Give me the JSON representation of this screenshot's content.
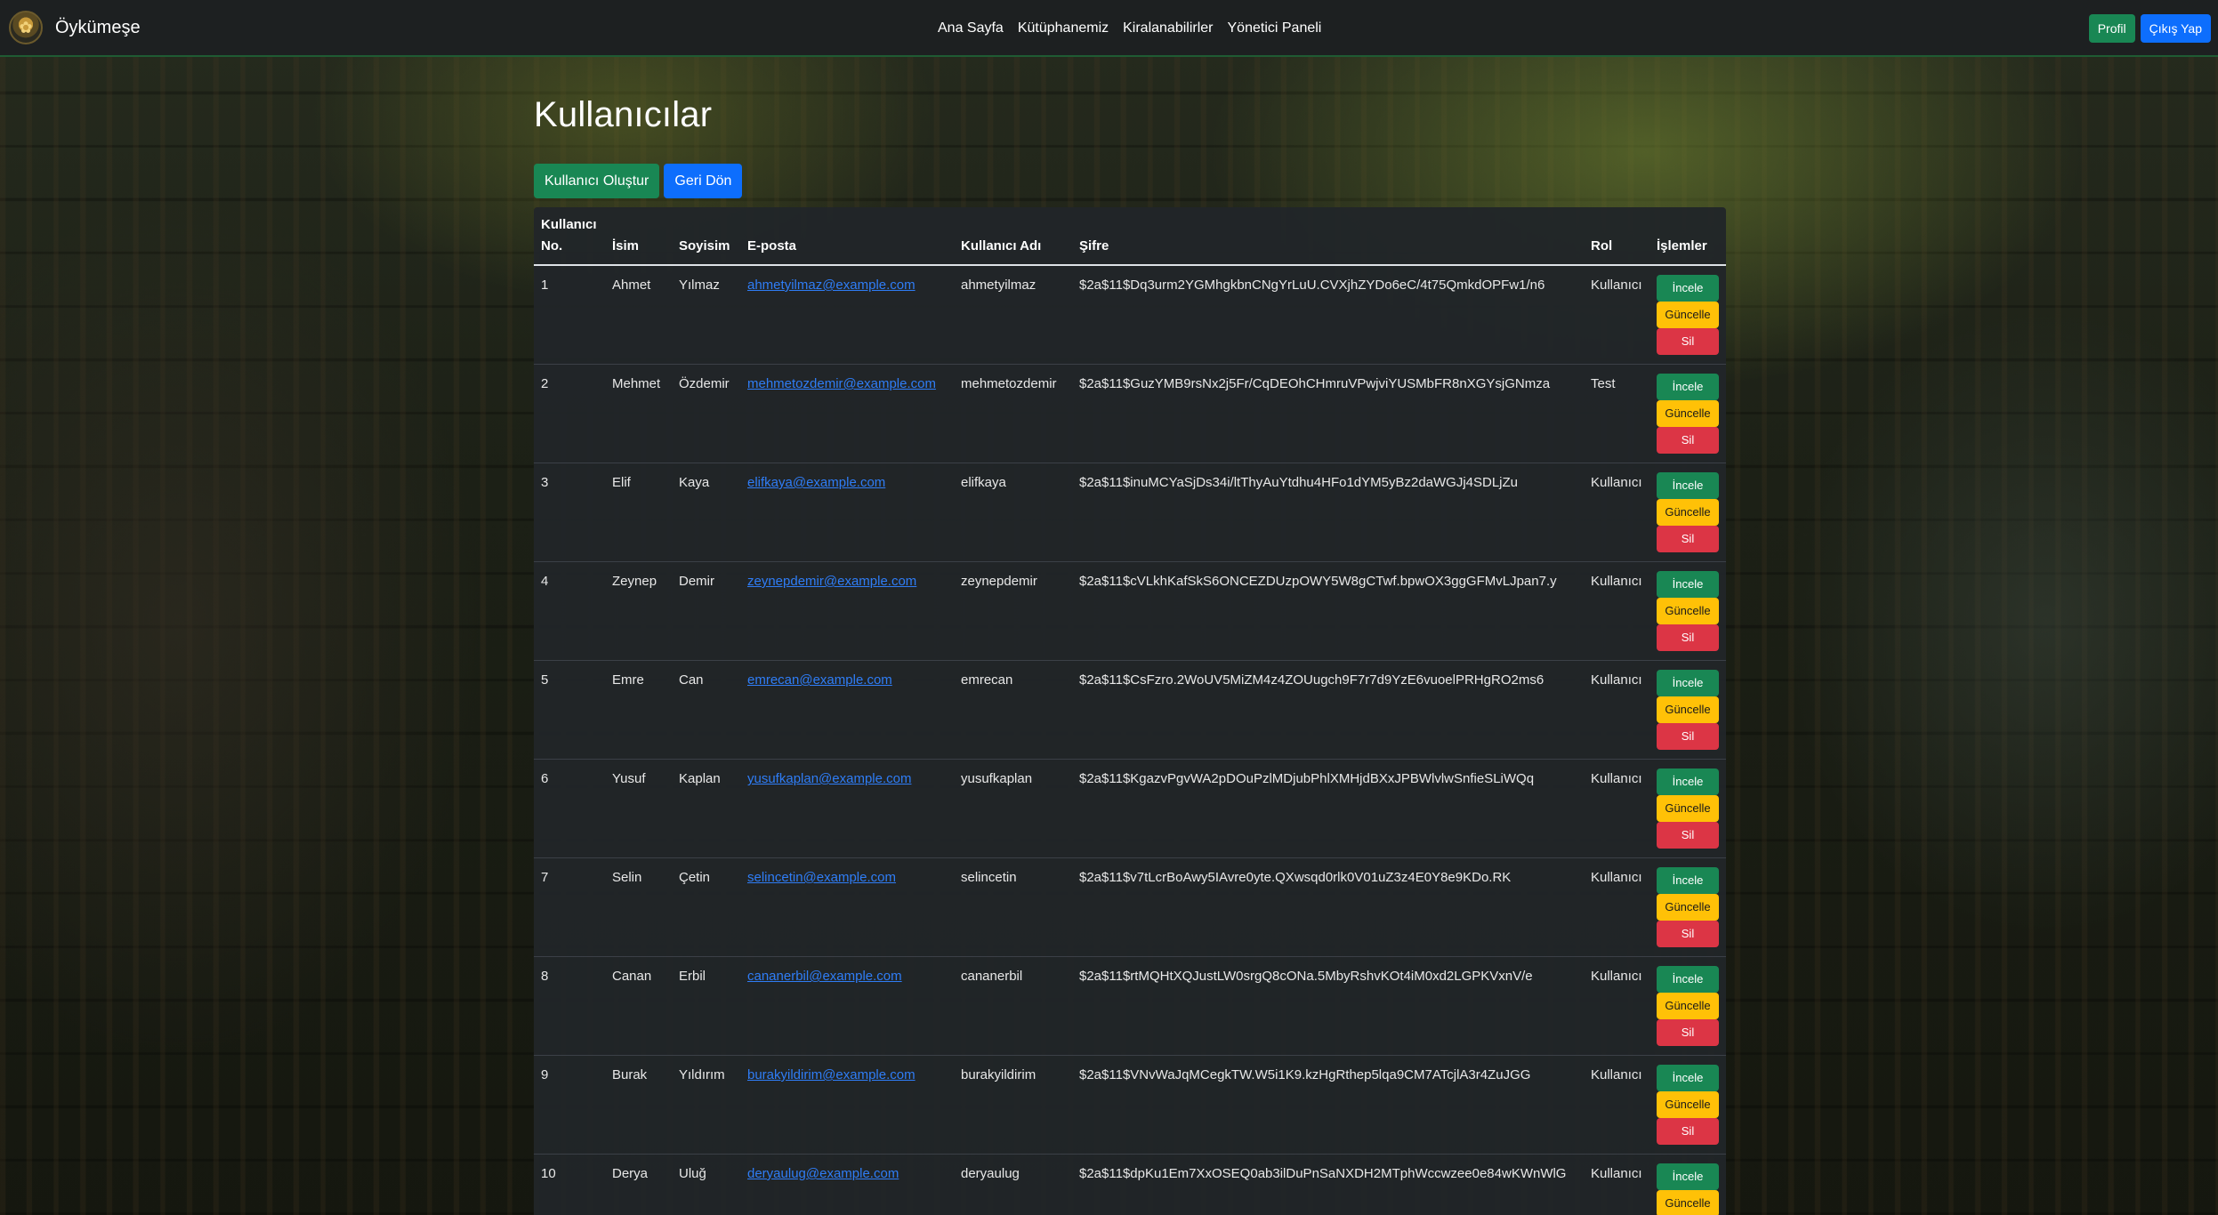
{
  "nav": {
    "brand": "Öykümeşe",
    "links": [
      "Ana Sayfa",
      "Kütüphanemiz",
      "Kiralanabilirler",
      "Yönetici Paneli"
    ],
    "profile": "Profil",
    "logout": "Çıkış Yap"
  },
  "page": {
    "title": "Kullanıcılar",
    "create_button": "Kullanıcı Oluştur",
    "back_button": "Geri Dön"
  },
  "table": {
    "headers": [
      "Kullanıcı No.",
      "İsim",
      "Soyisim",
      "E-posta",
      "Kullanıcı Adı",
      "Şifre",
      "Rol",
      "İşlemler"
    ],
    "op_labels": {
      "view": "İncele",
      "update": "Güncelle",
      "delete": "Sil"
    },
    "rows": [
      {
        "no": "1",
        "name": "Ahmet",
        "surname": "Yılmaz",
        "email": "ahmetyilmaz@example.com",
        "username": "ahmetyilmaz",
        "password": "$2a$11$Dq3urm2YGMhgkbnCNgYrLuU.CVXjhZYDo6eC/4t75QmkdOPFw1/n6",
        "role": "Kullanıcı"
      },
      {
        "no": "2",
        "name": "Mehmet",
        "surname": "Özdemir",
        "email": "mehmetozdemir@example.com",
        "username": "mehmetozdemir",
        "password": "$2a$11$GuzYMB9rsNx2j5Fr/CqDEOhCHmruVPwjviYUSMbFR8nXGYsjGNmza",
        "role": "Test"
      },
      {
        "no": "3",
        "name": "Elif",
        "surname": "Kaya",
        "email": "elifkaya@example.com",
        "username": "elifkaya",
        "password": "$2a$11$inuMCYaSjDs34i/ltThyAuYtdhu4HFo1dYM5yBz2daWGJj4SDLjZu",
        "role": "Kullanıcı"
      },
      {
        "no": "4",
        "name": "Zeynep",
        "surname": "Demir",
        "email": "zeynepdemir@example.com",
        "username": "zeynepdemir",
        "password": "$2a$11$cVLkhKafSkS6ONCEZDUzpOWY5W8gCTwf.bpwOX3ggGFMvLJpan7.y",
        "role": "Kullanıcı"
      },
      {
        "no": "5",
        "name": "Emre",
        "surname": "Can",
        "email": "emrecan@example.com",
        "username": "emrecan",
        "password": "$2a$11$CsFzro.2WoUV5MiZM4z4ZOUugch9F7r7d9YzE6vuoelPRHgRO2ms6",
        "role": "Kullanıcı"
      },
      {
        "no": "6",
        "name": "Yusuf",
        "surname": "Kaplan",
        "email": "yusufkaplan@example.com",
        "username": "yusufkaplan",
        "password": "$2a$11$KgazvPgvWA2pDOuPzlMDjubPhlXMHjdBXxJPBWlvlwSnfieSLiWQq",
        "role": "Kullanıcı"
      },
      {
        "no": "7",
        "name": "Selin",
        "surname": "Çetin",
        "email": "selincetin@example.com",
        "username": "selincetin",
        "password": "$2a$11$v7tLcrBoAwy5IAvre0yte.QXwsqd0rlk0V01uZ3z4E0Y8e9KDo.RK",
        "role": "Kullanıcı"
      },
      {
        "no": "8",
        "name": "Canan",
        "surname": "Erbil",
        "email": "cananerbil@example.com",
        "username": "cananerbil",
        "password": "$2a$11$rtMQHtXQJustLW0srgQ8cONa.5MbyRshvKOt4iM0xd2LGPKVxnV/e",
        "role": "Kullanıcı"
      },
      {
        "no": "9",
        "name": "Burak",
        "surname": "Yıldırım",
        "email": "burakyildirim@example.com",
        "username": "burakyildirim",
        "password": "$2a$11$VNvWaJqMCegkTW.W5i1K9.kzHgRthep5lqa9CM7ATcjlA3r4ZuJGG",
        "role": "Kullanıcı"
      },
      {
        "no": "10",
        "name": "Derya",
        "surname": "Uluğ",
        "email": "deryaulug@example.com",
        "username": "deryaulug",
        "password": "$2a$11$dpKu1Em7XxOSEQ0ab3ilDuPnSaNXDH2MTphWccwzee0e84wKWnWlG",
        "role": "Kullanıcı"
      }
    ]
  },
  "colors": {
    "green": "#198754",
    "blue": "#0d6efd",
    "yellow": "#ffc107",
    "red": "#dc3545",
    "table_bg": "#212529"
  }
}
